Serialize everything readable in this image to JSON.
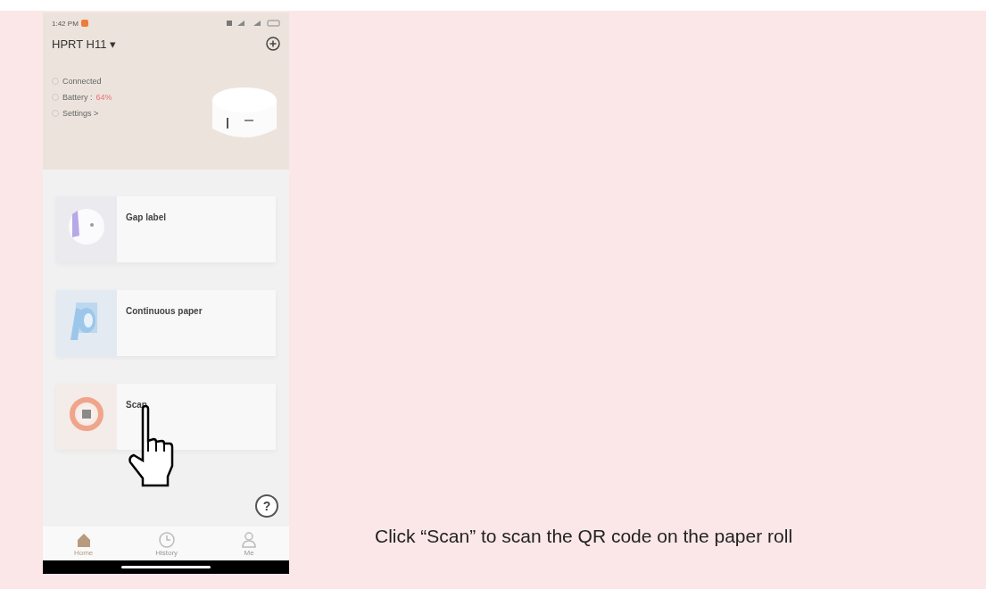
{
  "status_bar": {
    "time": "1:42 PM"
  },
  "device": {
    "name": "HPRT H11 ▾"
  },
  "device_status": [
    {
      "label": "Connected"
    },
    {
      "label": "Battery :",
      "value": "64%"
    },
    {
      "label": "Settings >"
    }
  ],
  "paper_types": [
    {
      "kind": "gap",
      "title": "Gap label"
    },
    {
      "kind": "continuous",
      "title": "Continuous paper"
    },
    {
      "kind": "scan",
      "title": "Scan"
    }
  ],
  "help_button": {
    "label": "?"
  },
  "bottom_nav": [
    {
      "kind": "home",
      "label": "Home",
      "selected": true
    },
    {
      "kind": "history",
      "label": "History",
      "selected": false
    },
    {
      "kind": "me",
      "label": "Me",
      "selected": false
    }
  ],
  "caption": "Click “Scan” to scan the QR code on the paper roll"
}
